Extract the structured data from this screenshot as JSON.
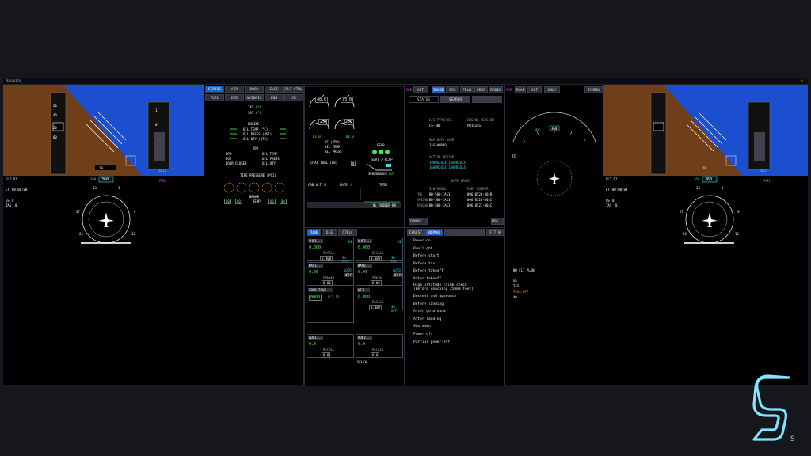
{
  "window": {
    "title": "Mosquito",
    "close": "✕"
  },
  "colors": {
    "sky": "#1c4fd0",
    "ground": "#6e3f18",
    "accent": "#1d62c8",
    "cyan": "#3fd8f0",
    "magenta": "#e050ff",
    "green": "#4dff5c",
    "amber": "#ffb020"
  },
  "pfd_left": {
    "spd": [
      "60",
      "40",
      "20",
      "00"
    ],
    "alt": [
      "1",
      "0",
      "-1"
    ],
    "baro": "1013",
    "hdg_readout": "19",
    "fd": "FLT DI",
    "hdg": "360",
    "crs": "360",
    "mode": "FMS1",
    "gs": "0",
    "tas": "0",
    "et": "00:00:00",
    "compass": [
      "33",
      "3",
      "27",
      "9",
      "24",
      "12"
    ],
    "wind": "0",
    "oat": "0"
  },
  "pfd_right": {
    "hdg": "360",
    "crs": "360",
    "mode": "FMS1",
    "fd": "FLT DI",
    "compass": [
      "33",
      "3",
      "27",
      "9",
      "24",
      "12"
    ],
    "gs": "0",
    "tas": "0",
    "et": "00:00:00",
    "baro": "1013",
    "hdg_readout": "19"
  },
  "status_panel": {
    "tabs_row1": [
      "STATUS",
      "AIR",
      "DOOR",
      "ELEC",
      "FLT CTRL"
    ],
    "tabs_row2": [
      "FUEL",
      "HYD",
      "AVIONIC",
      "ENG",
      "CB"
    ],
    "tat_label": "TAT",
    "tat": "0°C",
    "sat_label": "SAT",
    "sat": "0°C",
    "engine_head": "ENGINE",
    "engine_rows": [
      "OIL TEMP (°C)",
      "OIL PRESS (PSI)",
      "OIL QTY (QTS)"
    ],
    "apu_head": "APU",
    "apu_left": [
      "RPM",
      "EGT",
      "DOOR"
    ],
    "apu_door": "CLOSED",
    "apu_right": [
      "OIL TEMP",
      "OIL PRESS",
      "OIL QTY"
    ],
    "tire_head": "TIRE PRESSURE (PSI)",
    "brake_label": "BRAKE",
    "temp_label": "TEMP",
    "tire_boxes": [
      "00",
      "00",
      "00",
      "00"
    ]
  },
  "eicas": {
    "n1_left": "48.0",
    "n1_right": "73.0",
    "itt_left": "250",
    "itt_right": "250",
    "ff_rows": [
      "FF (PPH)",
      "OIL TEMP",
      "OIL PRESS"
    ],
    "ff_left": "61.0",
    "ff_right": "61.0",
    "total_fuel_label": "TOTAL FUEL (LB)",
    "total_fuel": "0",
    "gear_label": "GEAR",
    "slat_flap": "SLAT / FLAP",
    "speed_brake": "SPEEDBRAKE",
    "speed_brake_val": "OUT",
    "cab_alt_label": "CAB ALT",
    "cab_alt": "0",
    "rate_label": "RATE",
    "rate": "0",
    "trim_label": "TRIM",
    "rudder_label": "NL  RUDDER  NR"
  },
  "fms": {
    "mfd_label": "MFD",
    "act_label": "ACT",
    "tabs": [
      "IMAGE",
      "POS",
      "FPLN",
      "PERF",
      "RADIO"
    ],
    "subtabs": [
      "STATUS",
      "SEARCH",
      ""
    ],
    "a_c_type_label": "A/C TYPE/REG",
    "a_c_type": "CS-300",
    "engine_label": "ENGINE VERSION",
    "engine": "PW1524G",
    "nav_data_label": "NAV DATA BASE",
    "nav_data": "JAS-WORLD",
    "active_label": "ACTIVE PERIOD",
    "active_rows": [
      "18APR2024 16APR2024",
      "16APR2024 18APR2024"
    ],
    "data_bases_label": "DATA BASES",
    "sw_model_label": "S/W MODEL",
    "part_label": "PART NUMBER",
    "sw_rows": [
      {
        "name": "FMS",
        "model": "BD-500-1A11",
        "part": "096-0526-001R"
      },
      {
        "name": "APS500",
        "model": "BD-500-1A11",
        "part": "096-0526-001C"
      },
      {
        "name": "APS600",
        "model": "BD-500-1A11",
        "part": "096-0527-001C"
      }
    ],
    "thrust_btn": "THRUST...",
    "msg_btn": "MSG..."
  },
  "radio": {
    "tabs": [
      "TUNE",
      "DLE",
      "CPDLC"
    ],
    "boxes": [
      {
        "title": "VHF1...",
        "freq": "0.000",
        "sub": "RECALL",
        "sub_val": "0.000",
        "side": "HI",
        "extra": "SQ OFF"
      },
      {
        "title": "VHF2...",
        "freq": "0.000",
        "sub": "RECALL",
        "sub_val": "0.000",
        "side": "HI",
        "extra": "SQ OFF"
      },
      {
        "title": "NAV1...",
        "freq": "0.00",
        "sub": "PRESET",
        "sub_val": "0.00",
        "side": "AUTO",
        "extra": "HOLD"
      },
      {
        "title": "NAV2...",
        "freq": "0.00",
        "sub": "PRESET",
        "sub_val": "0.00",
        "side": "AUTO",
        "extra": "HOLD"
      },
      {
        "title": "XPDR TCAS...",
        "freq": "0000",
        "sub": "FLT ID",
        "sub_val": "",
        "side": "",
        "extra": ""
      },
      {
        "title": "HF1...",
        "freq": "0.000",
        "sub": "RECALL",
        "sub_val": "0.000",
        "side": "",
        "extra": "SQ OFF"
      },
      {
        "title": "ADF1...",
        "freq": "0.0",
        "sub": "RECALL",
        "sub_val": "0.0",
        "side": "",
        "extra": ""
      },
      {
        "title": "ADF2...",
        "freq": "0.0",
        "sub": "RECALL",
        "sub_val": "0.0",
        "side": "",
        "extra": ""
      }
    ],
    "selcal": "SELCAL"
  },
  "checklist": {
    "tabs": [
      "CHKLST",
      "NORMAL",
      "",
      "",
      ""
    ],
    "fit_label": "FIT W",
    "items": [
      "Power-on",
      "Preflight",
      "Before start",
      "Before taxi",
      "Before takeoff",
      "After takeoff",
      "High altitude climb check",
      "(Before reaching 25000 feet)",
      "Descent and approach",
      "Before landing",
      "After go-around",
      "After landing",
      "Shutdown",
      "Power-off",
      "Partial power-off"
    ]
  },
  "map": {
    "mfd_label": "MAP",
    "plan_label": "PLAN",
    "act_label": "ACT",
    "only_label": "ONLY",
    "symbol_label": "SYMBOL",
    "hdg": "360",
    "trk": "TRK",
    "no_fpln": "NO FLT PLAN",
    "gs_label": "GS",
    "tas_label": "TAS",
    "tcas_off": "TCAS OFF",
    "fd_label": "FD",
    "range": "40"
  }
}
